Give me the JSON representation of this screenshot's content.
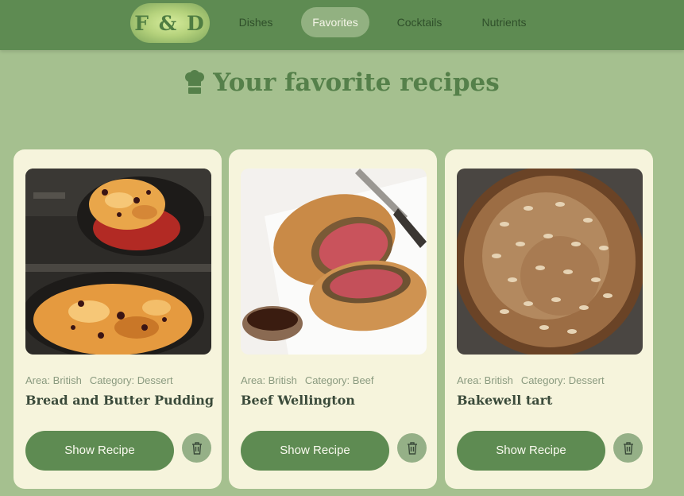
{
  "nav": {
    "logo": "F & D",
    "links": [
      "Dishes",
      "Favorites",
      "Cocktails",
      "Nutrients"
    ],
    "active": "Favorites"
  },
  "page": {
    "title": "Your favorite recipes",
    "title_icon": "chef-hat-icon"
  },
  "recipes": [
    {
      "area": "Area: British",
      "category": "Category: Dessert",
      "name": "Bread and Butter Pudding",
      "button": "Show Recipe",
      "delete_icon": "trash-icon"
    },
    {
      "area": "Area: British",
      "category": "Category: Beef",
      "name": "Beef Wellington",
      "button": "Show Recipe",
      "delete_icon": "trash-icon"
    },
    {
      "area": "Area: British",
      "category": "Category: Dessert",
      "name": "Bakewell tart",
      "button": "Show Recipe",
      "delete_icon": "trash-icon"
    }
  ],
  "colors": {
    "background": "#a5c08f",
    "navbar": "#5e8b52",
    "card": "#f6f4dc",
    "accent": "#5e8b52",
    "title": "#55804a"
  }
}
